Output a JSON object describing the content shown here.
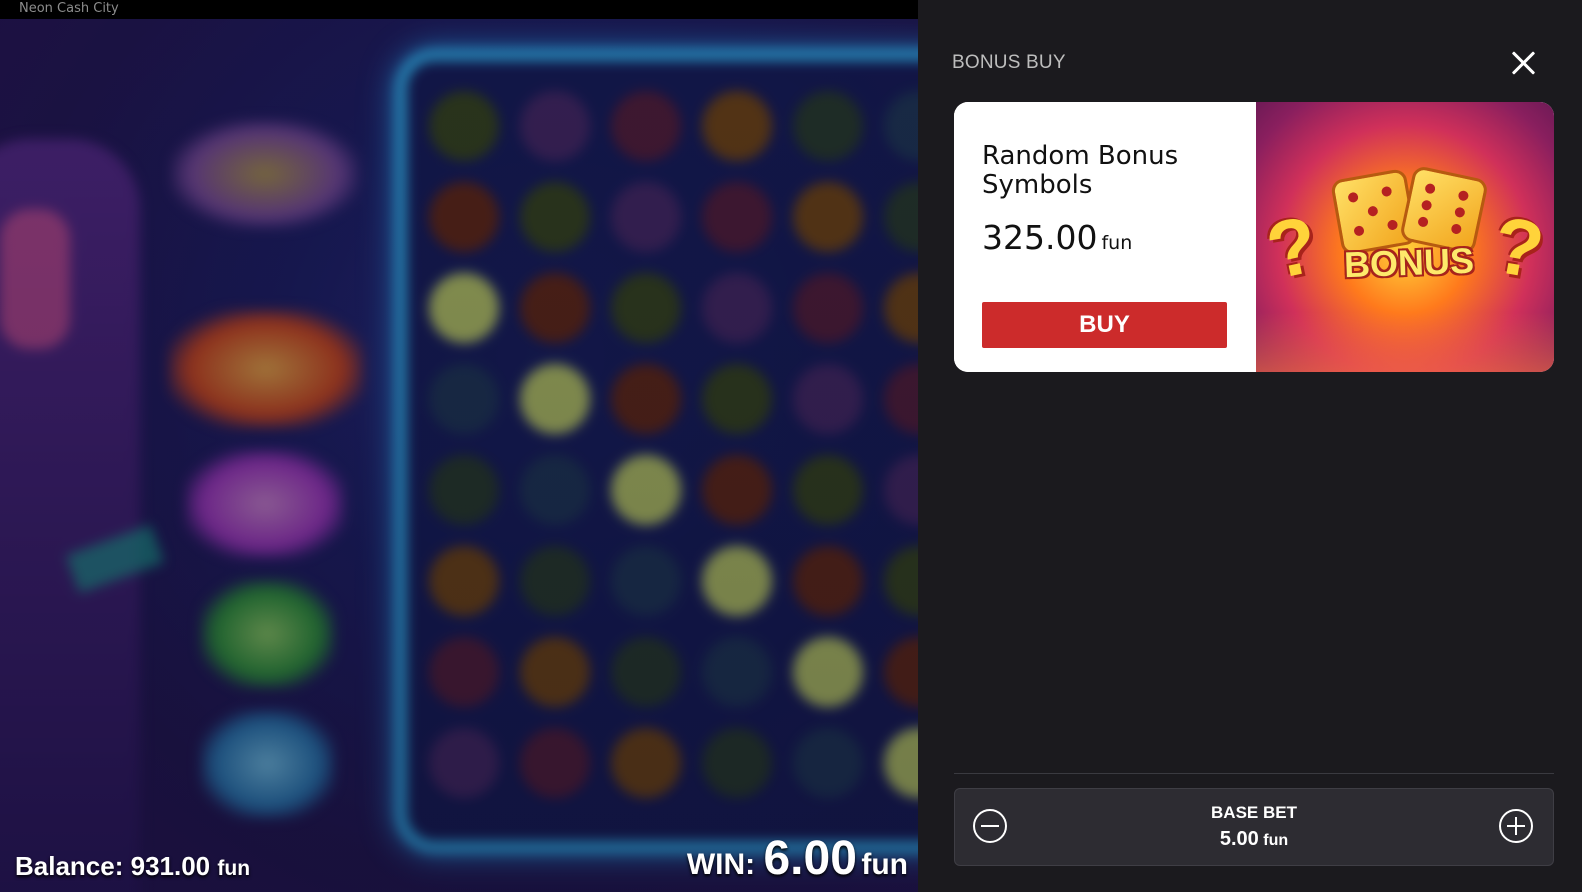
{
  "window": {
    "title": "Neon Cash City"
  },
  "game": {
    "balance_label": "Balance: ",
    "balance_value": "931.00",
    "balance_unit": "fun",
    "win_label": "WIN: ",
    "win_value": "6.00",
    "win_unit": "fun"
  },
  "panel": {
    "title": "BONUS BUY",
    "close_icon": "close-icon",
    "card": {
      "name": "Random Bonus Symbols",
      "price": "325.00",
      "unit": "fun",
      "buy_label": "BUY",
      "art_text": "BONUS",
      "art_qmark": "?"
    },
    "bet": {
      "label": "BASE BET",
      "value": "5.00",
      "unit": "fun",
      "minus_icon": "minus-circle-icon",
      "plus_icon": "plus-circle-icon"
    }
  },
  "colors": {
    "panel_bg": "#1b1a1e",
    "buy_button": "#cc2b2b",
    "bet_box": "#2d2c32",
    "title_text": "#bdbdbd"
  }
}
